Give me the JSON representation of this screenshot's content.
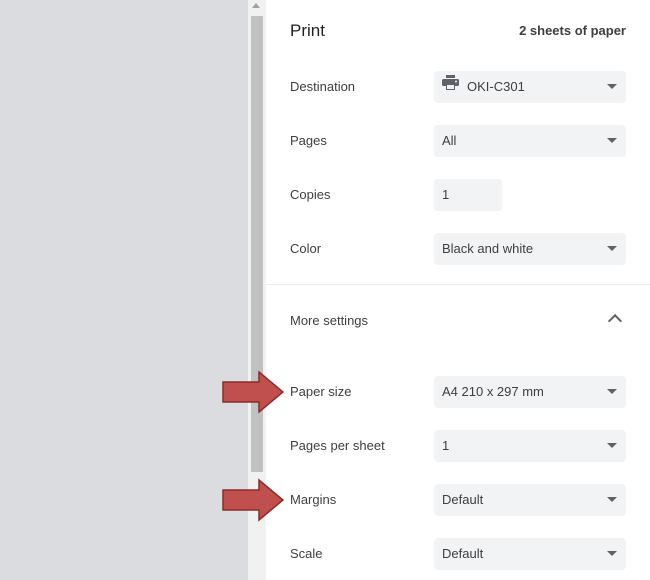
{
  "header": {
    "title": "Print",
    "sheets": "2 sheets of paper"
  },
  "destination": {
    "label": "Destination",
    "value": "OKI-C301",
    "icon": "printer-icon"
  },
  "pages": {
    "label": "Pages",
    "value": "All"
  },
  "copies": {
    "label": "Copies",
    "value": "1"
  },
  "color": {
    "label": "Color",
    "value": "Black and white"
  },
  "more_settings": {
    "label": "More settings",
    "icon": "chevron-up-icon"
  },
  "paper_size": {
    "label": "Paper size",
    "value": "A4 210 x 297 mm"
  },
  "pages_per_sheet": {
    "label": "Pages per sheet",
    "value": "1"
  },
  "margins": {
    "label": "Margins",
    "value": "Default"
  },
  "scale": {
    "label": "Scale",
    "value": "Default"
  },
  "annotations": {
    "arrow_color": "#c0504d",
    "arrow_border": "#8b2c2a"
  }
}
